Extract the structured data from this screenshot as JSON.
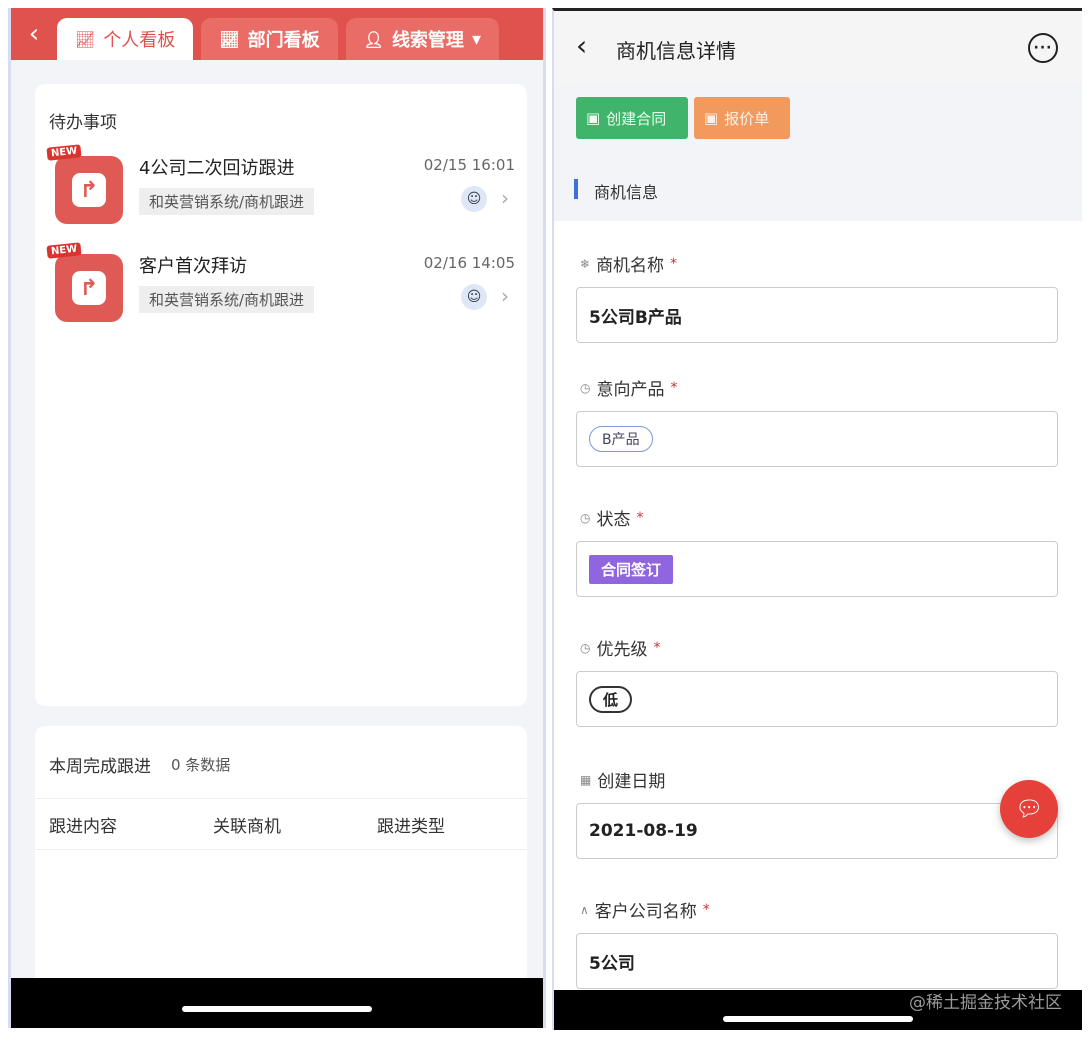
{
  "left": {
    "tabs": [
      {
        "label": "个人看板",
        "icon": "trend-chart-icon",
        "active": true
      },
      {
        "label": "部门看板",
        "icon": "trend-chart-icon",
        "active": false
      },
      {
        "label": "线索管理",
        "icon": "person-icon",
        "active": false,
        "dropdown": "▾"
      }
    ],
    "todo": {
      "title": "待办事项",
      "badge": "NEW",
      "items": [
        {
          "name": "4公司二次回访跟进",
          "tag": "和英营销系统/商机跟进",
          "time": "02/15 16:01"
        },
        {
          "name": "客户首次拜访",
          "tag": "和英营销系统/商机跟进",
          "time": "02/16 14:05"
        }
      ]
    },
    "week": {
      "title": "本周完成跟进",
      "count": "0 条数据",
      "columns": [
        "跟进内容",
        "关联商机",
        "跟进类型"
      ]
    }
  },
  "right": {
    "nav": {
      "title": "商机信息详情",
      "more": "···"
    },
    "actions": {
      "create_contract": "创建合同",
      "quote": "报价单"
    },
    "section": "商机信息",
    "fields": {
      "name_label": "商机名称",
      "name_value": "5公司B产品",
      "product_label": "意向产品",
      "product_value": "B产品",
      "status_label": "状态",
      "status_value": "合同签订",
      "priority_label": "优先级",
      "priority_value": "低",
      "date_label": "创建日期",
      "date_value": "2021-08-19",
      "customer_label": "客户公司名称",
      "customer_value": "5公司"
    },
    "required_mark": "*"
  },
  "watermark": "@稀土掘金技术社区",
  "colors": {
    "brand_red": "#e0524d",
    "green": "#41b46b",
    "orange": "#f29a5e",
    "purple": "#8f66df",
    "accent_blue": "#3d6fd8"
  }
}
